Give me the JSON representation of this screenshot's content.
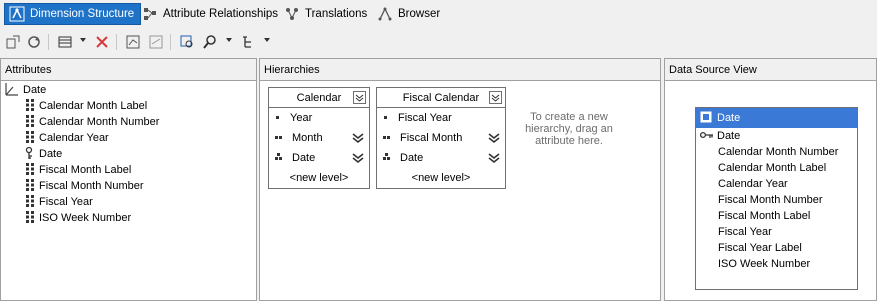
{
  "tabs": [
    {
      "label": "Dimension Structure",
      "active": true,
      "icon": "dimension-structure-icon"
    },
    {
      "label": "Attribute Relationships",
      "active": false,
      "icon": "relationships-icon"
    },
    {
      "label": "Translations",
      "active": false,
      "icon": "translations-icon"
    },
    {
      "label": "Browser",
      "active": false,
      "icon": "browser-icon"
    }
  ],
  "panes": {
    "attributes": {
      "title": "Attributes"
    },
    "hierarchies": {
      "title": "Hierarchies"
    },
    "dsv": {
      "title": "Data Source View"
    }
  },
  "attributes": {
    "root": "Date",
    "items": [
      {
        "label": "Calendar Month Label",
        "icon": "attribute-icon"
      },
      {
        "label": "Calendar Month Number",
        "icon": "attribute-icon"
      },
      {
        "label": "Calendar Year",
        "icon": "attribute-icon"
      },
      {
        "label": "Date",
        "icon": "key-attribute-icon"
      },
      {
        "label": "Fiscal Month Label",
        "icon": "attribute-icon"
      },
      {
        "label": "Fiscal Month Number",
        "icon": "attribute-icon"
      },
      {
        "label": "Fiscal Year",
        "icon": "attribute-icon"
      },
      {
        "label": "ISO Week Number",
        "icon": "attribute-icon"
      }
    ]
  },
  "hierarchies": [
    {
      "title": "Calendar",
      "levels": [
        {
          "label": "Year",
          "warning": false
        },
        {
          "label": "Month",
          "warning": true
        },
        {
          "label": "Date",
          "warning": true
        }
      ],
      "new_level": "<new level>"
    },
    {
      "title": "Fiscal Calendar",
      "levels": [
        {
          "label": "Fiscal Year",
          "warning": false
        },
        {
          "label": "Fiscal Month",
          "warning": true
        },
        {
          "label": "Date",
          "warning": true
        }
      ],
      "new_level": "<new level>"
    }
  ],
  "hierarchy_hint": "To create a new hierarchy, drag an attribute here.",
  "dsv": {
    "table_name": "Date",
    "key_column": "Date",
    "columns": [
      "Calendar Month Number",
      "Calendar Month Label",
      "Calendar Year",
      "Fiscal Month Number",
      "Fiscal Month Label",
      "Fiscal Year",
      "Fiscal Year Label",
      "ISO Week Number"
    ]
  },
  "colors": {
    "active_tab": "#1e73c8",
    "dsv_header": "#3b79d6"
  }
}
